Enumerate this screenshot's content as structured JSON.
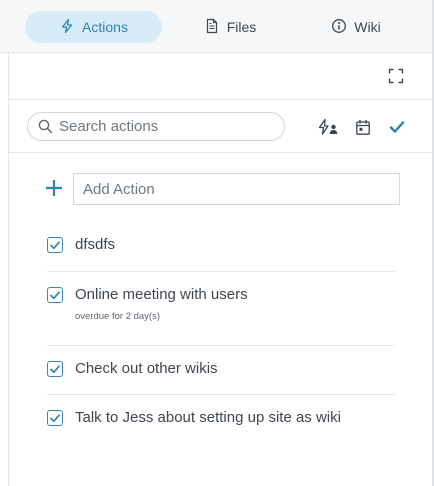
{
  "tabs": [
    {
      "label": "Actions",
      "icon": "bolt-icon",
      "active": true
    },
    {
      "label": "Files",
      "icon": "file-icon",
      "active": false
    },
    {
      "label": "Wiki",
      "icon": "info-icon",
      "active": false
    }
  ],
  "search": {
    "placeholder": "Search actions"
  },
  "add_action": {
    "placeholder": "Add Action"
  },
  "actions": [
    {
      "label": "dfsdfs",
      "checked": true
    },
    {
      "label": "Online meeting with users",
      "note": "overdue for 2 day(s)",
      "checked": true
    },
    {
      "label": "Check out other wikis",
      "checked": true
    },
    {
      "label": "Talk to Jess about setting up site as wiki",
      "checked": true
    }
  ],
  "colors": {
    "accent": "#2d83b0",
    "active_tab_bg": "#d7ecf6"
  }
}
